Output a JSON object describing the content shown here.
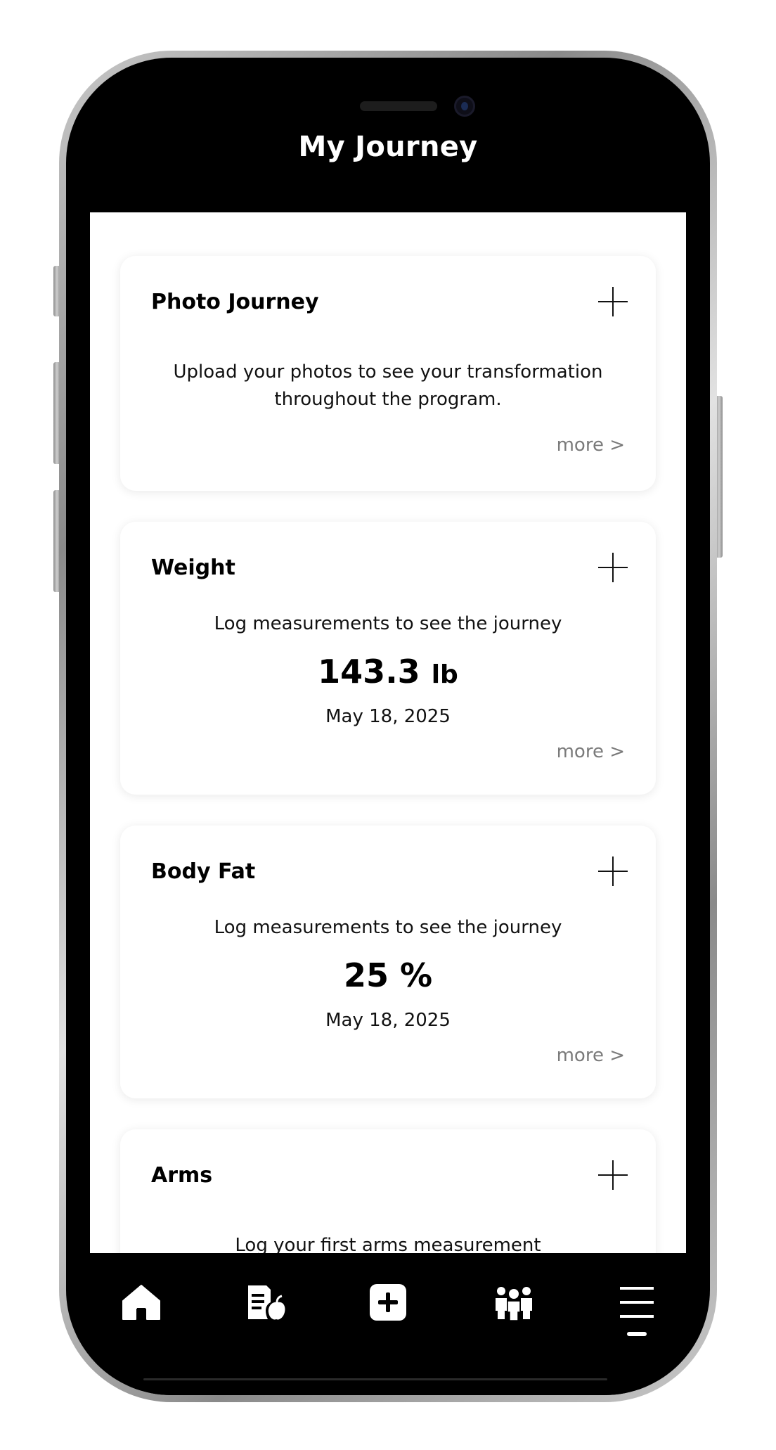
{
  "header": {
    "title": "My Journey"
  },
  "cards": {
    "photo": {
      "title": "Photo Journey",
      "description": "Upload your photos to see your transformation throughout the program.",
      "more": "more >"
    },
    "weight": {
      "title": "Weight",
      "description": "Log measurements to see the journey",
      "value": "143.3",
      "unit": "lb",
      "date": "May 18, 2025",
      "more": "more >"
    },
    "body_fat": {
      "title": "Body Fat",
      "description": "Log measurements to see the journey",
      "value": "25 %",
      "date": "May 18, 2025",
      "more": "more >"
    },
    "arms": {
      "title": "Arms",
      "description": "Log your first arms measurement"
    }
  },
  "tabbar": {
    "icons": [
      "home-icon",
      "nutrition-log-icon",
      "add-icon",
      "community-icon",
      "menu-icon"
    ],
    "active": "menu"
  },
  "colors": {
    "frame_background": "#000000",
    "card_background": "#ffffff",
    "muted_text": "#7a7a7a"
  }
}
